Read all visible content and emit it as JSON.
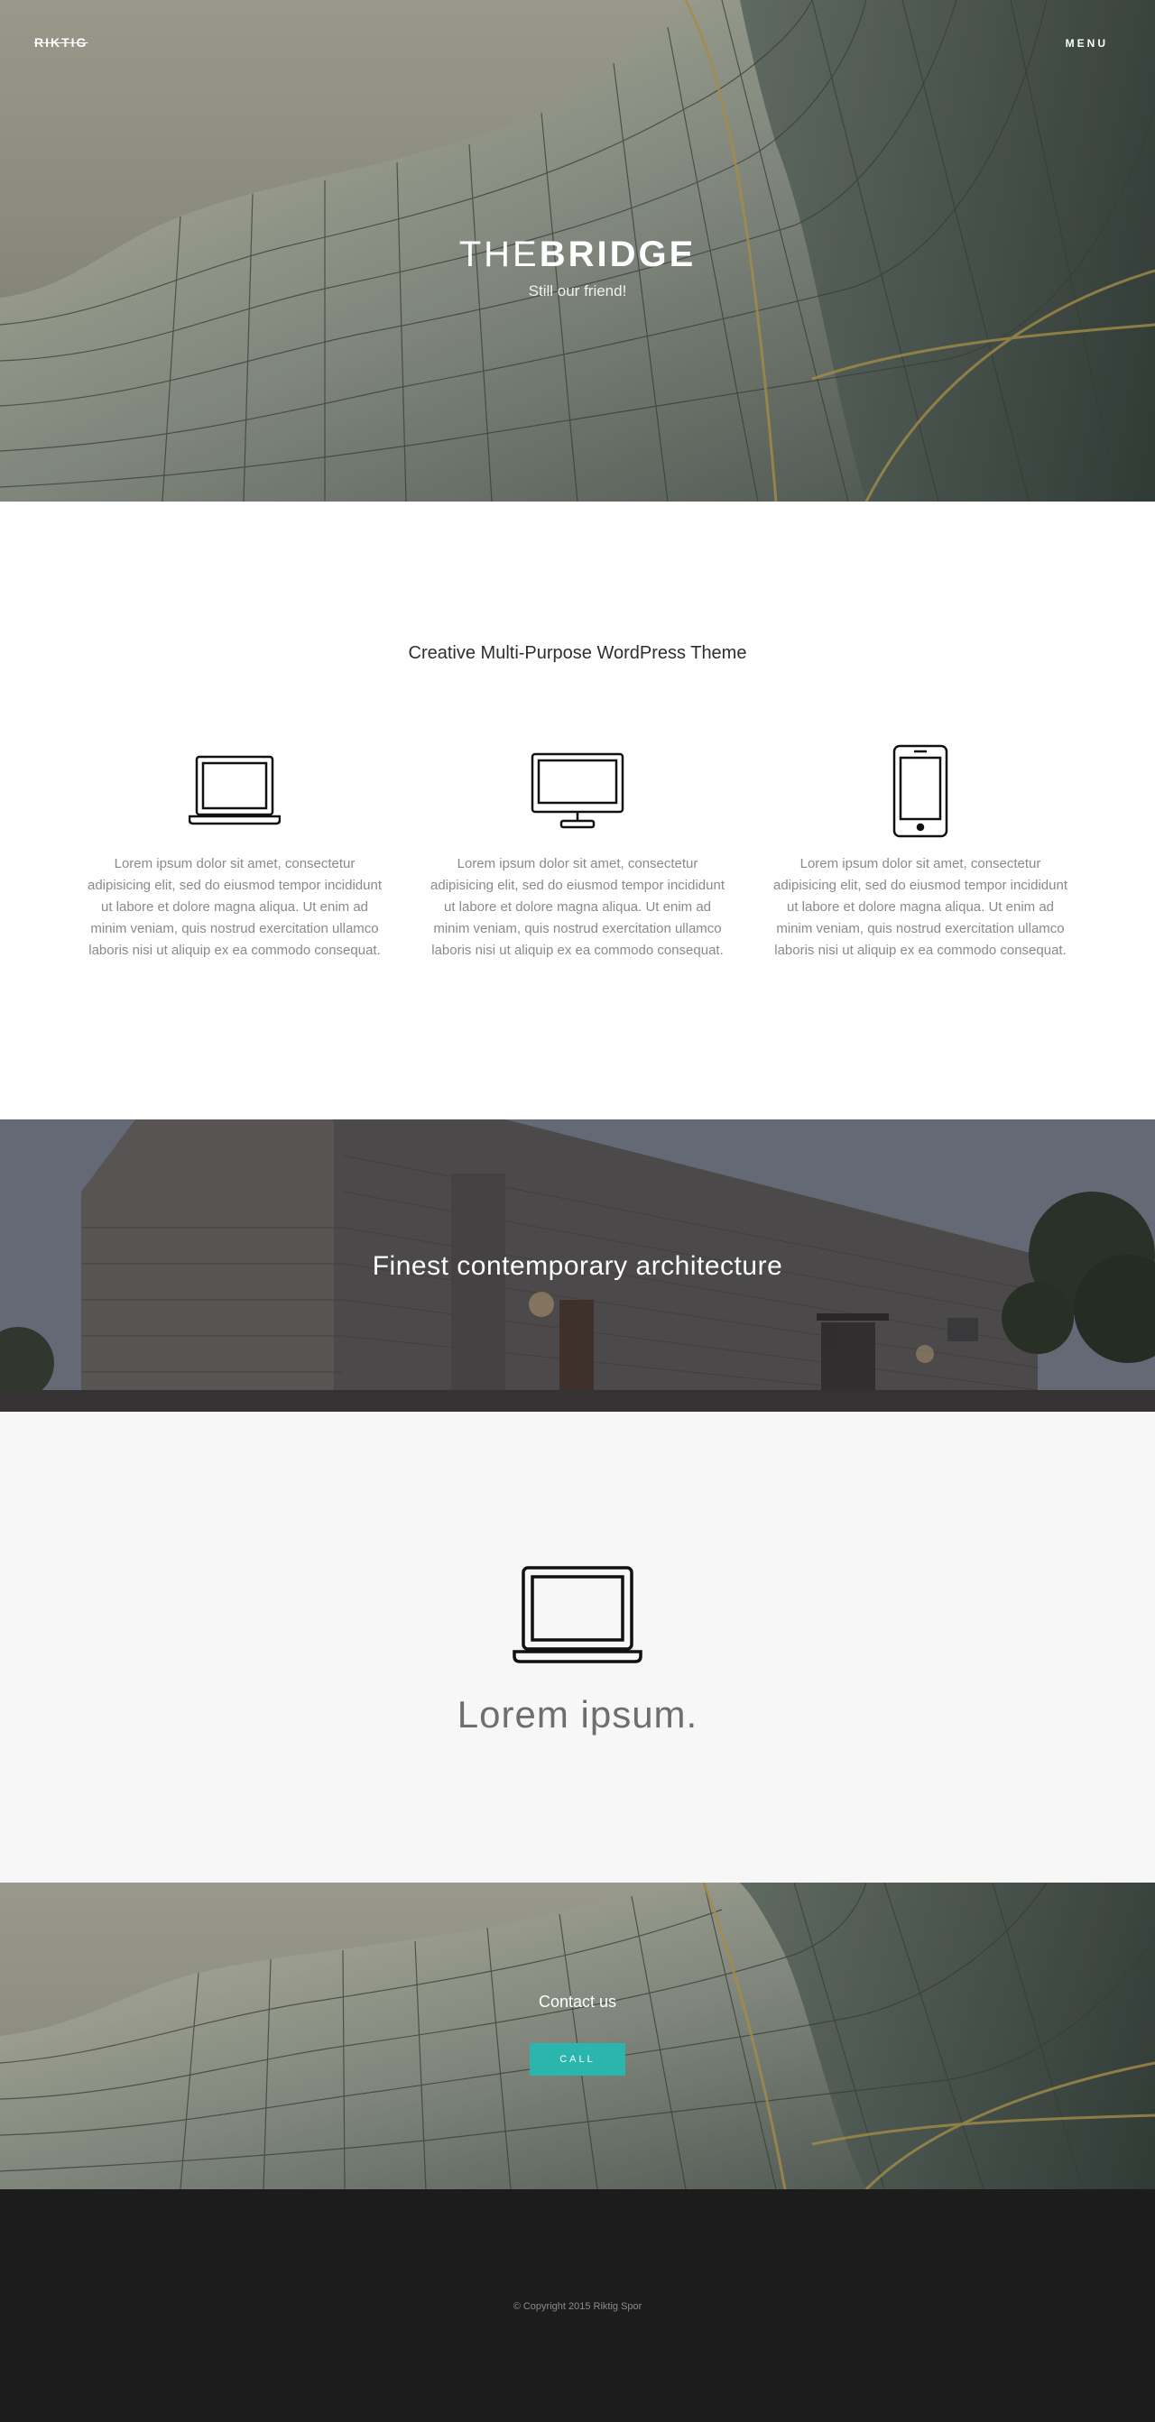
{
  "header": {
    "logo": "RIKTIG",
    "menu_label": "MENU"
  },
  "hero": {
    "title_light": "THE",
    "title_bold": "BRIDGE",
    "subtitle": "Still our friend!"
  },
  "features": {
    "heading": "Creative Multi-Purpose WordPress Theme",
    "items": [
      {
        "icon": "laptop-icon",
        "text": "Lorem ipsum dolor sit amet, consectetur adipisicing elit, sed do eiusmod tempor incididunt ut labore et dolore magna aliqua. Ut enim ad minim veniam, quis nostrud exercitation ullamco laboris nisi ut aliquip ex ea commodo consequat."
      },
      {
        "icon": "desktop-monitor-icon",
        "text": "Lorem ipsum dolor sit amet, consectetur adipisicing elit, sed do eiusmod tempor incididunt ut labore et dolore magna aliqua. Ut enim ad minim veniam, quis nostrud exercitation ullamco laboris nisi ut aliquip ex ea commodo consequat."
      },
      {
        "icon": "smartphone-icon",
        "text": "Lorem ipsum dolor sit amet, consectetur adipisicing elit, sed do eiusmod tempor incididunt ut labore et dolore magna aliqua. Ut enim ad minim veniam, quis nostrud exercitation ullamco laboris nisi ut aliquip ex ea commodo consequat."
      }
    ]
  },
  "banner": {
    "title": "Finest contemporary architecture"
  },
  "lorem": {
    "icon": "laptop-icon",
    "title": "Lorem ipsum."
  },
  "contact": {
    "title": "Contact us",
    "button_label": "CALL"
  },
  "footer": {
    "copyright": "© Copyright 2015 Riktig Spor"
  },
  "colors": {
    "accent": "#2ab5ad",
    "footer_bg": "#1c1c1c",
    "lorem_bg": "#f7f7f7"
  }
}
